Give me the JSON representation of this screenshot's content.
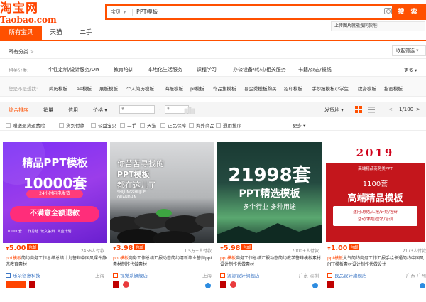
{
  "header": {
    "logo_main": "淘宝网",
    "logo_sub": "Taobao.com",
    "search_scope": "宝贝",
    "search_query": "PPT模板",
    "search_button": "搜 索",
    "image_search_tip": "上传图片就能搜同款啦!"
  },
  "tabs": [
    "所有宝贝",
    "天猫",
    "二手"
  ],
  "category": {
    "all_label": "所有分类",
    "all_arrow": ">",
    "sort_dropdown": "收起筛选"
  },
  "related": {
    "label": "相关分类:",
    "items": [
      "个性定制/设计服务/DIY",
      "教育培训",
      "本地化生活服务",
      "课程学习",
      "办公设备/耗材/相关服务",
      "书籍/杂志/报纸"
    ],
    "more": "更多"
  },
  "like": {
    "label": "您是不是想找:",
    "items": [
      "简历模板",
      "ae模板",
      "展板模板",
      "个人简历模板",
      "海报模板",
      "pr模板",
      "作品集模板",
      "易企秀模板购买",
      "招印模板",
      "手抄报模板小学生",
      "纹身模板",
      "指画模板"
    ]
  },
  "sortbar": {
    "items": [
      "综合排序",
      "销量",
      "信用",
      "价格"
    ],
    "price_from": "¥",
    "price_to": "¥",
    "dash": "-",
    "ship_from": "发货地",
    "page": "1/100",
    "prev": "<",
    "next": ">"
  },
  "filters": {
    "items": [
      "赠送退货运费险",
      "货到付款",
      "公益宝贝",
      "二手",
      "天猫",
      "正品保障",
      "海外商品",
      "通用排序"
    ],
    "more": "更多"
  },
  "products": [
    {
      "image": {
        "headline": "精品PPT模板",
        "number": "10000套",
        "ribbon": "24小时内电发货",
        "slogan": "不满意全额退款",
        "features": [
          "10000套",
          "工作总结",
          "论文答辩",
          "商业计划"
        ]
      },
      "price_symbol": "¥",
      "price": "5.00",
      "bao": "包邮",
      "payers": "2456人付款",
      "title_hl": "ppt模板",
      "title_rest": "简约商务工作总结总结计划答辩中国风课件静态教育素材",
      "shop": "乐朵创意科技",
      "location": "上海"
    },
    {
      "image": {
        "line1": "你苦苦寻找的",
        "line2": "PPT模板",
        "line3": "都在这儿了",
        "pinyin1": "SHIJUNGSHUJUE",
        "pinyin2": "QUANDIAN"
      },
      "price_symbol": "¥",
      "price": "3.98",
      "bao": "包邮",
      "payers": "1.5万+人付款",
      "title_hl": "ppt模板",
      "title_rest": "商务工作总结汇报动态简约清新毕业答辩ppt素材制作代做素材",
      "shop": "视觉系旗舰店",
      "location": "上海"
    },
    {
      "image": {
        "number": "21998套",
        "line2": "PPT精选模板",
        "line3": "多个行业 多种用途"
      },
      "price_symbol": "¥",
      "price": "5.98",
      "bao": "包邮",
      "payers": "7000+人付款",
      "title_hl": "ppt模板",
      "title_rest": "商务工作总结汇报动态简约教学答辩模板素材设计制作代做素材",
      "shop": "源源设计旗舰店",
      "location": "广东 深圳"
    },
    {
      "image": {
        "year": "2019",
        "top": "高端精品商务类PPT",
        "count": "1100套",
        "title": "高端精品模板",
        "sub1": "适用:总结/汇报/计划/答辩",
        "sub2": "活动/策划/营销/培训"
      },
      "price_symbol": "¥",
      "price": "1.00",
      "bao": "包邮",
      "payers": "2173人付款",
      "title_hl": "ppt模板",
      "title_rest": "大气简约商务工作汇报手绘卡通简约中国风PPT模板素材设计制作代做设计",
      "shop": "良品设计旗舰店",
      "location": "广东 广州"
    }
  ],
  "colors": {
    "brand": "#ff5000",
    "price": "#ff4400",
    "link": "#3c76c4"
  }
}
